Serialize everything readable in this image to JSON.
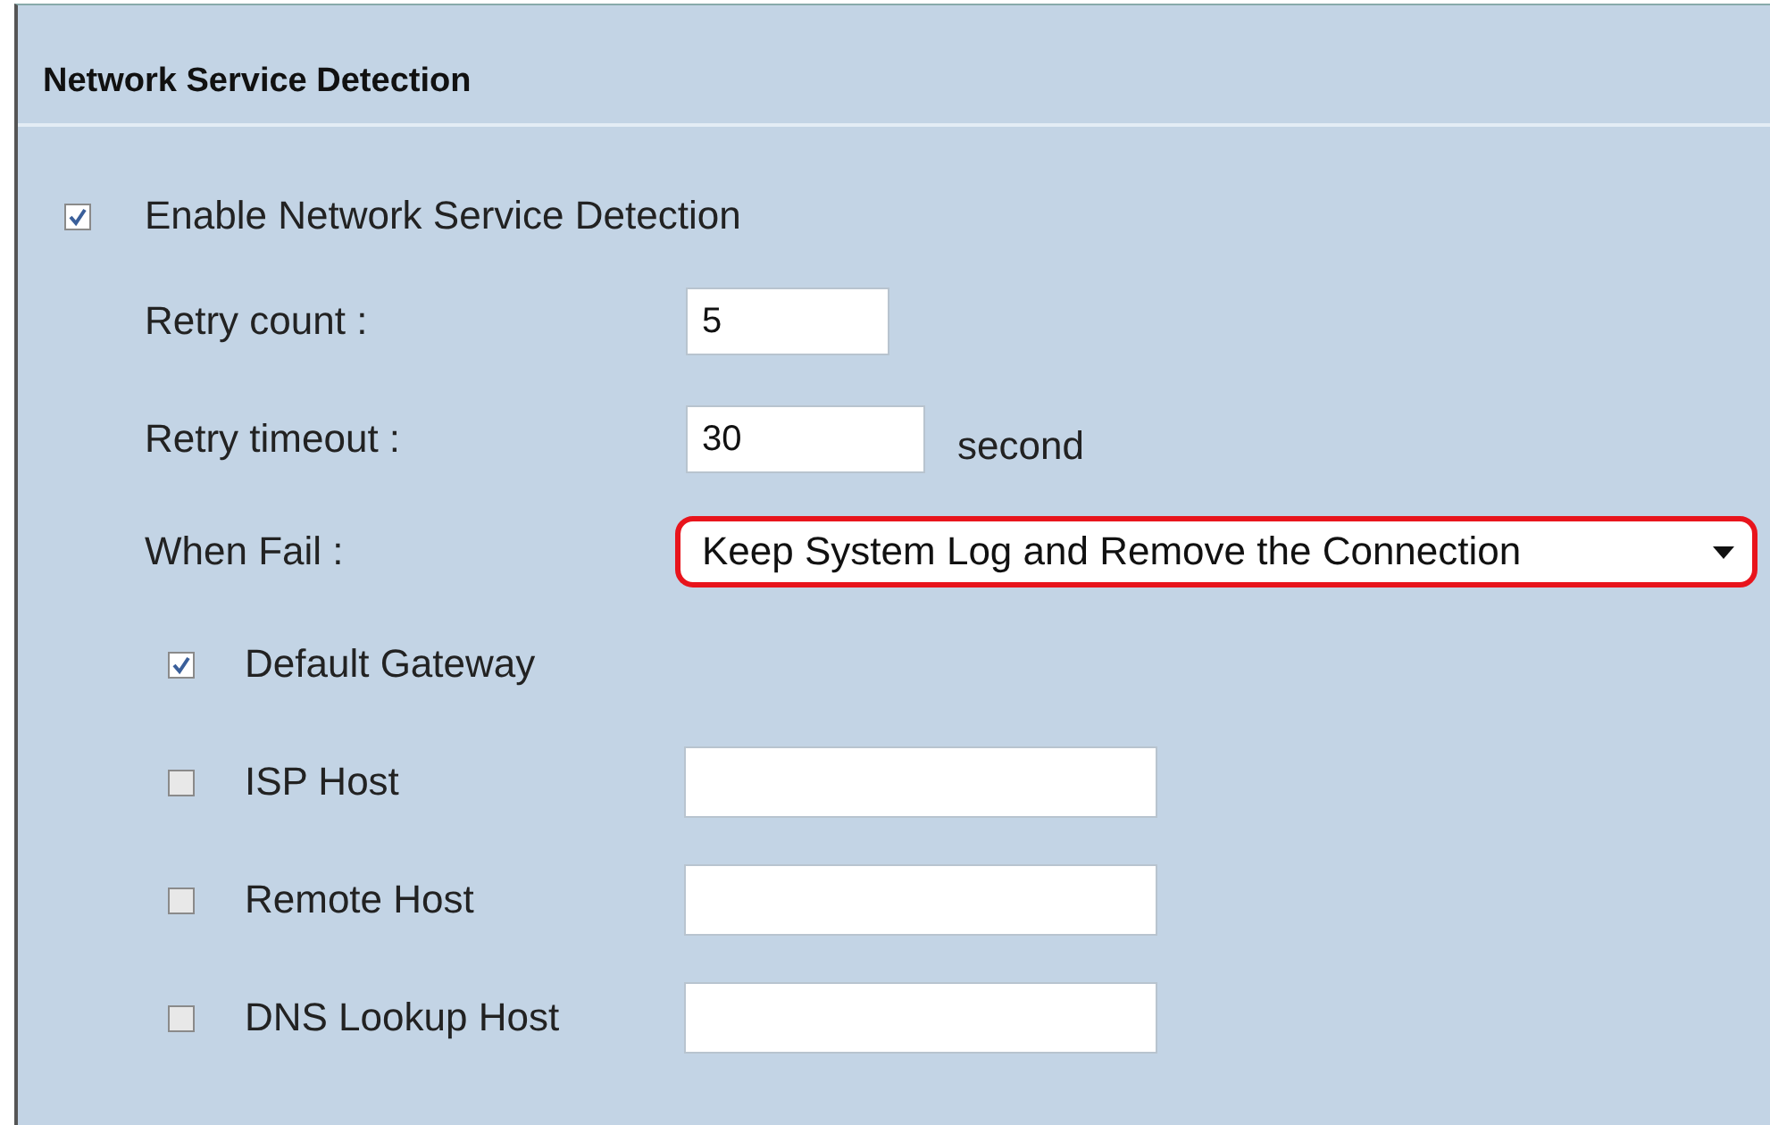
{
  "section": {
    "title": "Network Service Detection"
  },
  "enable": {
    "label": "Enable Network Service Detection",
    "checked": true
  },
  "fields": [
    {
      "label": "Retry count :",
      "value": "5"
    },
    {
      "label": "Retry timeout :",
      "value": "30",
      "unit": "second"
    }
  ],
  "when_fail": {
    "label": "When Fail :",
    "value": "Keep System Log and Remove the Connection",
    "highlighted": true
  },
  "hosts": [
    {
      "label": "Default Gateway",
      "checked": true,
      "has_field": false
    },
    {
      "label": "ISP Host",
      "checked": false,
      "has_field": true
    },
    {
      "label": "Remote Host",
      "checked": false,
      "has_field": true
    },
    {
      "label": "DNS Lookup Host",
      "checked": false,
      "has_field": true
    }
  ]
}
